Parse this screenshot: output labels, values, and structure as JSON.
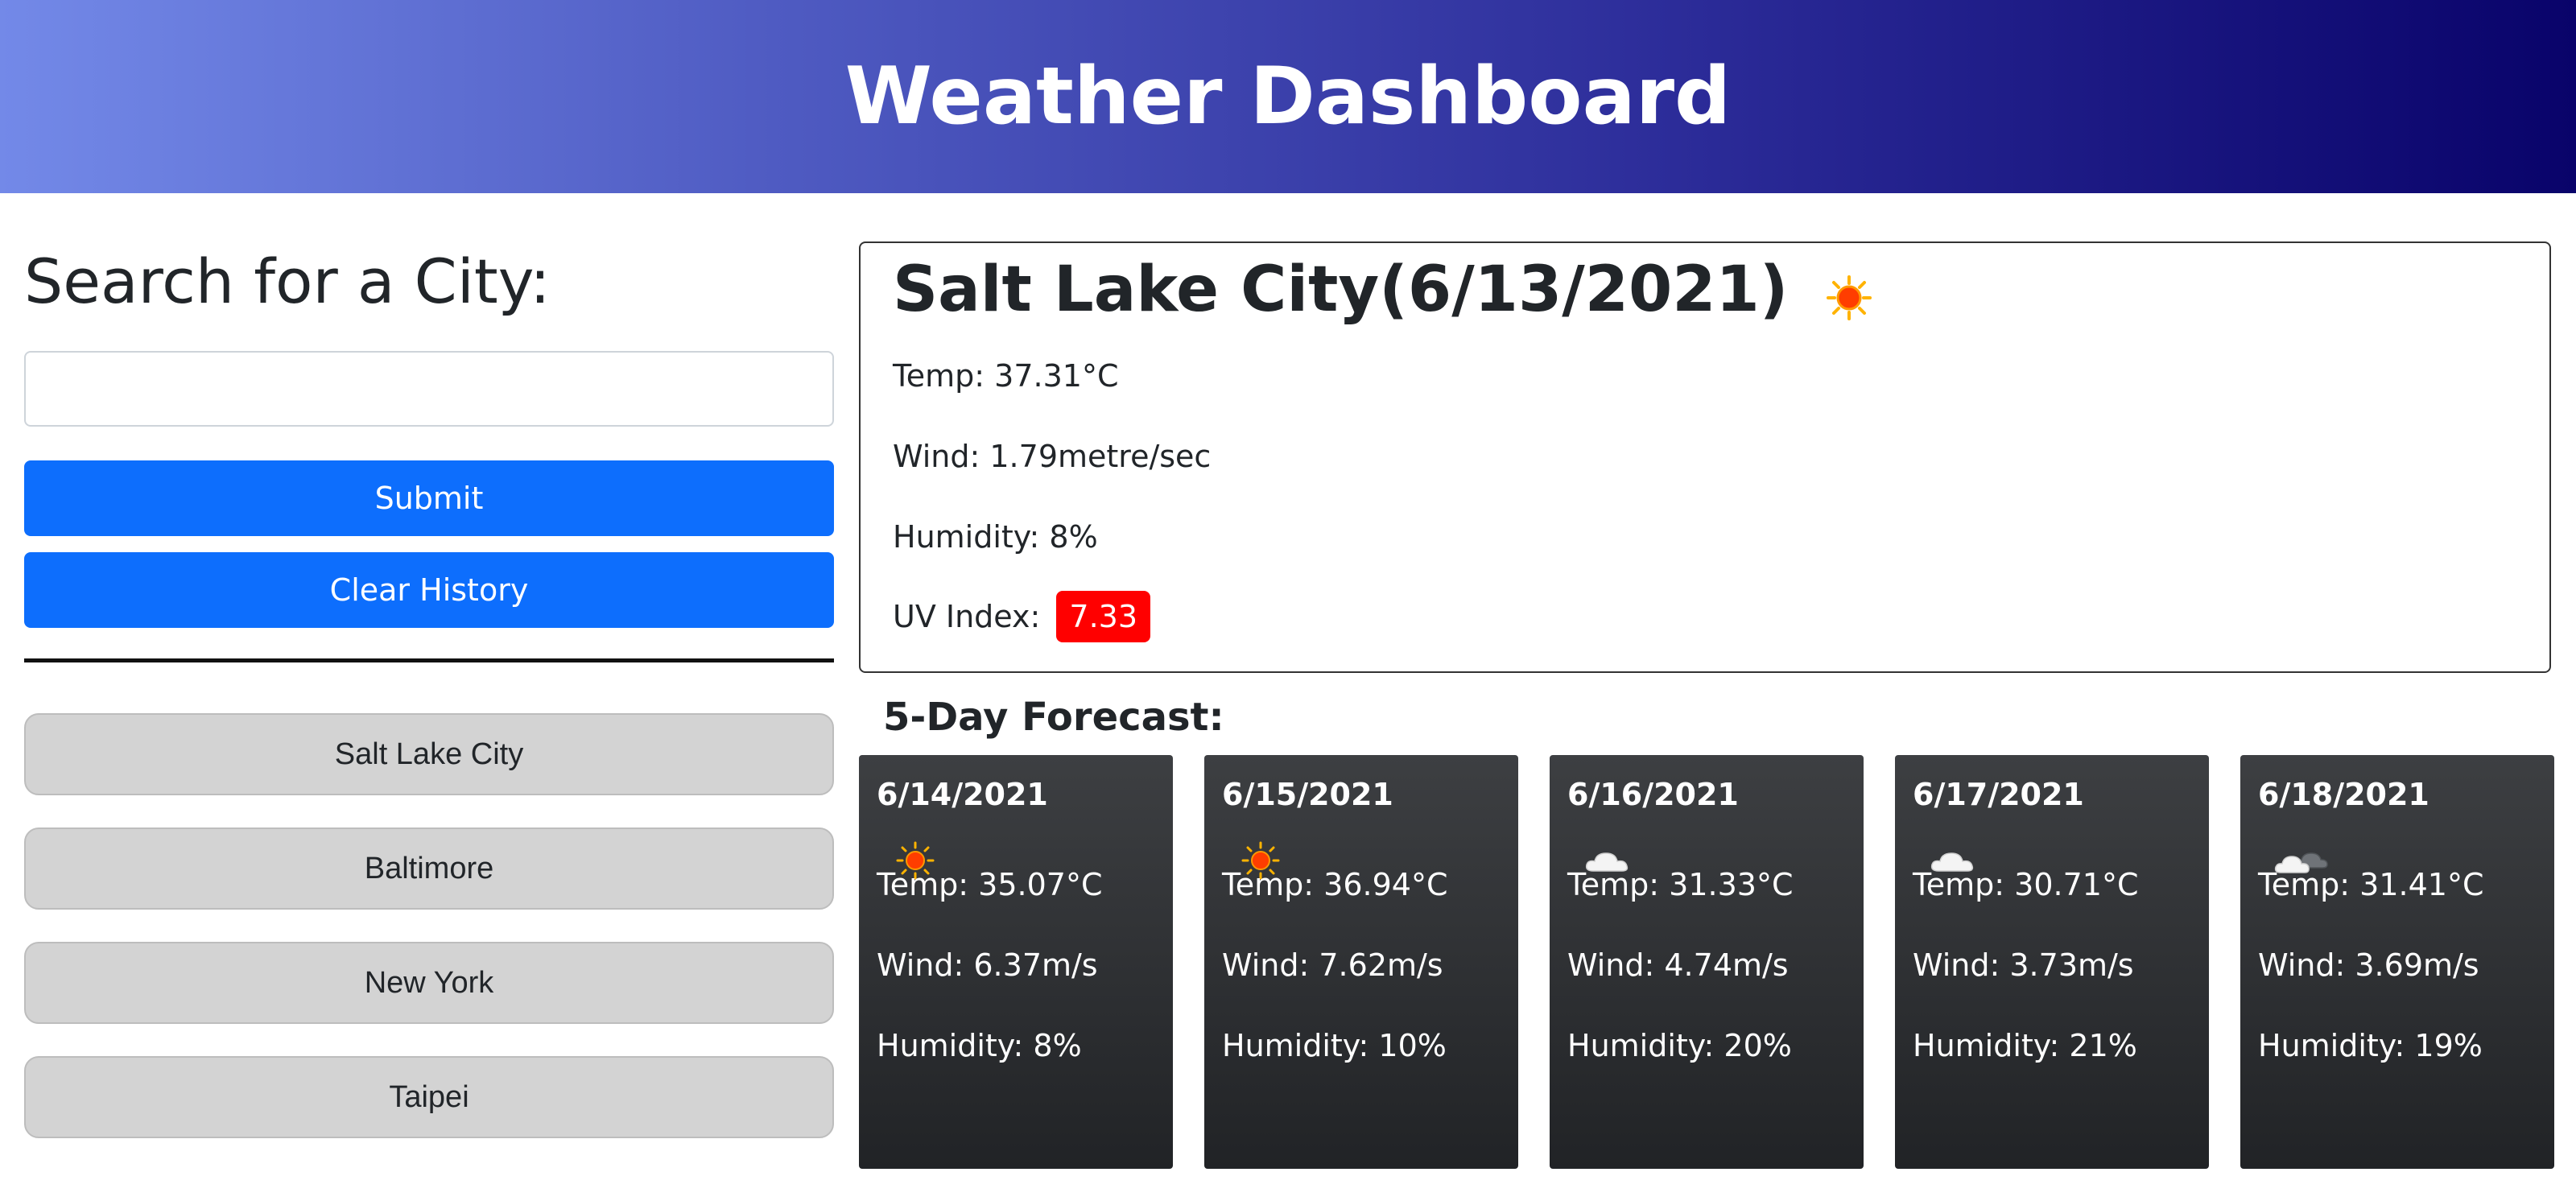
{
  "header": {
    "title": "Weather Dashboard"
  },
  "search": {
    "title": "Search for a City:",
    "input_value": "",
    "submit_label": "Submit",
    "clear_label": "Clear History"
  },
  "history": [
    "Salt Lake City",
    "Baltimore",
    "New York",
    "Taipei"
  ],
  "current": {
    "title": "Salt Lake City(6/13/2021)",
    "icon": "sun-icon",
    "temp": "Temp: 37.31°C",
    "wind": "Wind: 1.79metre/sec",
    "humidity": "Humidity: 8%",
    "uv_label": "UV Index:",
    "uv_value": "7.33",
    "uv_color": "#ff0000"
  },
  "forecast": {
    "title": "5-Day Forecast:",
    "days": [
      {
        "date": "6/14/2021",
        "icon": "sun-icon",
        "temp": "Temp: 35.07°C",
        "wind": "Wind: 6.37m/s",
        "humidity": "Humidity: 8%"
      },
      {
        "date": "6/15/2021",
        "icon": "sun-icon",
        "temp": "Temp: 36.94°C",
        "wind": "Wind: 7.62m/s",
        "humidity": "Humidity: 10%"
      },
      {
        "date": "6/16/2021",
        "icon": "cloud-icon",
        "temp": "Temp: 31.33°C",
        "wind": "Wind: 4.74m/s",
        "humidity": "Humidity: 20%"
      },
      {
        "date": "6/17/2021",
        "icon": "cloud-icon",
        "temp": "Temp: 30.71°C",
        "wind": "Wind: 3.73m/s",
        "humidity": "Humidity: 21%"
      },
      {
        "date": "6/18/2021",
        "icon": "dark-cloud-icon",
        "temp": "Temp: 31.41°C",
        "wind": "Wind: 3.69m/s",
        "humidity": "Humidity: 19%"
      }
    ]
  },
  "colors": {
    "header_gradient_start": "#7389e8",
    "header_gradient_end": "#09036a",
    "primary_button": "#0d6efd",
    "history_button": "#d3d3d3",
    "forecast_card": "#2b2d30"
  }
}
